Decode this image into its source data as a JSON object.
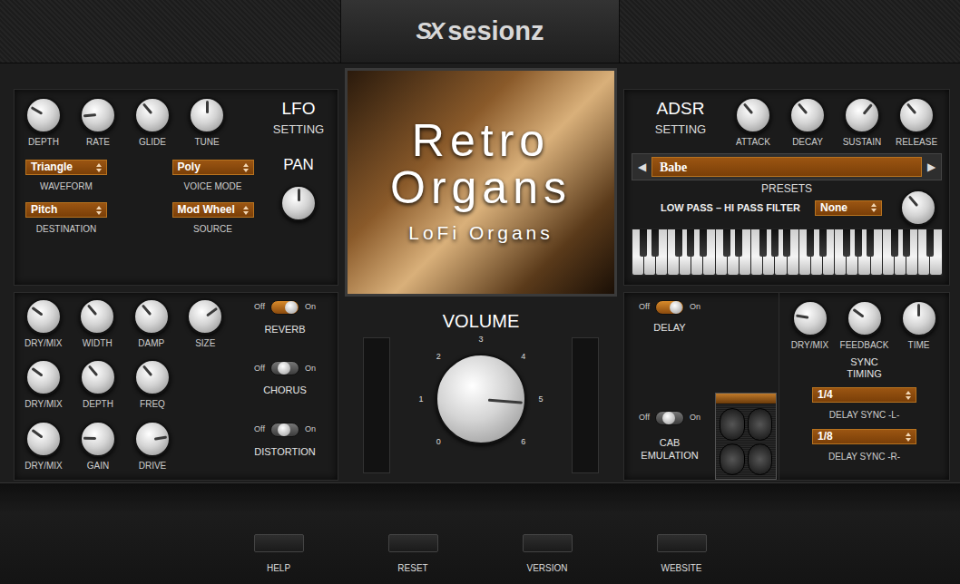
{
  "logo": {
    "mark": "SX",
    "name": "sesionz"
  },
  "lfo": {
    "title": "LFO",
    "subtitle": "SETTING",
    "knobs": [
      {
        "label": "DEPTH",
        "level": 0.28
      },
      {
        "label": "RATE",
        "level": 0.15
      },
      {
        "label": "GLIDE",
        "level": 0.35
      },
      {
        "label": "TUNE",
        "level": 0.5
      }
    ],
    "pan": {
      "label": "PAN",
      "level": 0.5
    },
    "selects": [
      {
        "value": "Triangle",
        "label": "WAVEFORM"
      },
      {
        "value": "Poly",
        "label": "VOICE MODE"
      },
      {
        "value": "Pitch",
        "label": "DESTINATION"
      },
      {
        "value": "Mod Wheel",
        "label": "SOURCE"
      }
    ]
  },
  "effects": [
    {
      "name": "REVERB",
      "on": true,
      "off_label": "Off",
      "on_label": "On",
      "knobs": [
        {
          "label": "DRY/MIX",
          "level": 0.3
        },
        {
          "label": "WIDTH",
          "level": 0.35
        },
        {
          "label": "DAMP",
          "level": 0.35
        },
        {
          "label": "SIZE",
          "level": 0.7
        }
      ]
    },
    {
      "name": "CHORUS",
      "on": false,
      "off_label": "Off",
      "on_label": "On",
      "knobs": [
        {
          "label": "DRY/MIX",
          "level": 0.3
        },
        {
          "label": "DEPTH",
          "level": 0.35
        },
        {
          "label": "FREQ",
          "level": 0.35
        }
      ]
    },
    {
      "name": "DISTORTION",
      "on": false,
      "off_label": "Off",
      "on_label": "On",
      "knobs": [
        {
          "label": "DRY/MIX",
          "level": 0.3
        },
        {
          "label": "GAIN",
          "level": 0.17
        },
        {
          "label": "DRIVE",
          "level": 0.8
        }
      ]
    }
  ],
  "cover": {
    "title": [
      "Retro",
      "Organs"
    ],
    "subtitle": "LoFi Organs"
  },
  "volume": {
    "label": "VOLUME",
    "level": 0.85,
    "scale": [
      "0",
      "1",
      "2",
      "3",
      "4",
      "5",
      "6"
    ],
    "meters": [
      {
        "level": 0
      },
      {
        "level": 0
      }
    ]
  },
  "adsr": {
    "title": "ADSR",
    "subtitle": "SETTING",
    "knobs": [
      {
        "label": "ATTACK",
        "level": 0.35
      },
      {
        "label": "DECAY",
        "level": 0.35
      },
      {
        "label": "SUSTAIN",
        "level": 0.65
      },
      {
        "label": "RELEASE",
        "level": 0.35
      }
    ]
  },
  "presets": {
    "prev": "◀",
    "next": "▶",
    "value": "Babe",
    "label": "PRESETS"
  },
  "filter": {
    "label": "LOW PASS – HI PASS FILTER",
    "value": "None",
    "level": 0.35
  },
  "delay": {
    "name": "DELAY",
    "on": true,
    "off_label": "Off",
    "on_label": "On",
    "knobs": [
      {
        "label": "DRY/MIX",
        "level": 0.2
      },
      {
        "label": "FEEDBACK",
        "level": 0.3
      },
      {
        "label": "TIME",
        "level": 0.5
      }
    ],
    "sync_label": [
      "SYNC",
      "TIMING"
    ],
    "syncs": [
      {
        "value": "1/4",
        "label": "DELAY SYNC -L-"
      },
      {
        "value": "1/8",
        "label": "DELAY SYNC -R-"
      }
    ]
  },
  "cab": {
    "label": [
      "CAB",
      "EMULATION"
    ],
    "on": false,
    "off_label": "Off",
    "on_label": "On"
  },
  "footer": [
    "HELP",
    "RESET",
    "VERSION",
    "WEBSITE"
  ]
}
